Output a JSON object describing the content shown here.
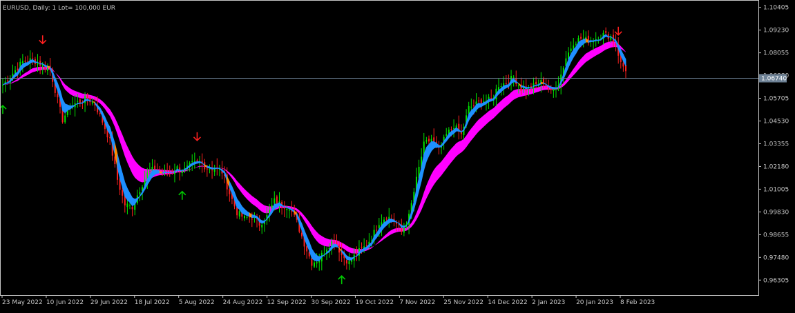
{
  "header": {
    "symbol_info": "EURUSD, Daily:  1 Lot= 100,000 EUR"
  },
  "chart_data": {
    "type": "candlestick",
    "symbol": "EURUSD",
    "timeframe": "Daily",
    "ylim": [
      0.9553,
      1.1075
    ],
    "y_ticks": [
      "1.10405",
      "1.09230",
      "1.08055",
      "1.06880",
      "1.05705",
      "1.04530",
      "1.03355",
      "1.02180",
      "1.01005",
      "0.99830",
      "0.98655",
      "0.97480",
      "0.96305"
    ],
    "x_ticks": [
      "23 May 2022",
      "10 Jun 2022",
      "29 Jun 2022",
      "18 Jul 2022",
      "5 Aug 2022",
      "24 Aug 2022",
      "12 Sep 2022",
      "30 Sep 2022",
      "19 Oct 2022",
      "7 Nov 2022",
      "25 Nov 2022",
      "14 Dec 2022",
      "2 Jan 2023",
      "20 Jan 2023",
      "8 Feb 2023"
    ],
    "current_price": "1.06740",
    "bar_count": 180,
    "close_path": [
      [
        0,
        1.064
      ],
      [
        4,
        1.07
      ],
      [
        8,
        1.076
      ],
      [
        12,
        1.077
      ],
      [
        16,
        1.074
      ],
      [
        19,
        1.072
      ],
      [
        22,
        1.056
      ],
      [
        24,
        1.046
      ],
      [
        27,
        1.053
      ],
      [
        30,
        1.055
      ],
      [
        34,
        1.057
      ],
      [
        37,
        1.054
      ],
      [
        40,
        1.045
      ],
      [
        43,
        1.035
      ],
      [
        46,
        1.015
      ],
      [
        49,
        1.002
      ],
      [
        52,
        1.001
      ],
      [
        55,
        1.01
      ],
      [
        58,
        1.018
      ],
      [
        61,
        1.021
      ],
      [
        64,
        1.018
      ],
      [
        67,
        1.019
      ],
      [
        70,
        1.021
      ],
      [
        73,
        1.02
      ],
      [
        76,
        1.023
      ],
      [
        79,
        1.024
      ],
      [
        82,
        1.021
      ],
      [
        85,
        1.021
      ],
      [
        88,
        1.019
      ],
      [
        91,
        1.008
      ],
      [
        94,
        0.998
      ],
      [
        97,
        0.995
      ],
      [
        100,
        0.996
      ],
      [
        103,
        0.992
      ],
      [
        106,
        0.996
      ],
      [
        109,
        1.004
      ],
      [
        112,
        1.002
      ],
      [
        115,
        1.001
      ],
      [
        118,
        0.993
      ],
      [
        121,
        0.982
      ],
      [
        124,
        0.972
      ],
      [
        127,
        0.974
      ],
      [
        130,
        0.98
      ],
      [
        133,
        0.984
      ],
      [
        136,
        0.976
      ],
      [
        139,
        0.972
      ],
      [
        142,
        0.977
      ],
      [
        145,
        0.98
      ],
      [
        148,
        0.985
      ],
      [
        151,
        0.993
      ],
      [
        154,
        0.996
      ],
      [
        157,
        0.994
      ],
      [
        160,
        0.988
      ],
      [
        163,
        0.996
      ],
      [
        166,
        1.015
      ],
      [
        169,
        1.033
      ],
      [
        172,
        1.036
      ],
      [
        175,
        1.03
      ],
      [
        178,
        1.038
      ],
      [
        181,
        1.043
      ],
      [
        184,
        1.038
      ],
      [
        187,
        1.052
      ],
      [
        190,
        1.054
      ],
      [
        193,
        1.056
      ],
      [
        196,
        1.056
      ],
      [
        199,
        1.064
      ],
      [
        202,
        1.065
      ],
      [
        205,
        1.068
      ],
      [
        208,
        1.062
      ],
      [
        211,
        1.062
      ],
      [
        214,
        1.064
      ],
      [
        217,
        1.066
      ],
      [
        220,
        1.06
      ],
      [
        223,
        1.065
      ],
      [
        226,
        1.078
      ],
      [
        229,
        1.086
      ],
      [
        232,
        1.088
      ],
      [
        235,
        1.087
      ],
      [
        238,
        1.088
      ],
      [
        241,
        1.09
      ],
      [
        244,
        1.089
      ],
      [
        246,
        1.085
      ],
      [
        248,
        1.075
      ],
      [
        250,
        1.072
      ]
    ],
    "signals": [
      {
        "type": "buy",
        "bar": 0
      },
      {
        "type": "sell",
        "bar": 16
      },
      {
        "type": "sell",
        "bar": 78
      },
      {
        "type": "buy",
        "bar": 72
      },
      {
        "type": "buy",
        "bar": 136
      },
      {
        "type": "sell",
        "bar": 247
      }
    ],
    "colors": {
      "background": "#000000",
      "frame": "#c8c8c8",
      "bull_candle": "#00e600",
      "bear_candle": "#ff2020",
      "fast_band": "#1e90ff",
      "fast_band_down": "#ff8c00",
      "slow_band": "#ff00ff",
      "price_line": "#6e8296",
      "price_label_bg": "#6e8296",
      "buy_arrow": "#00c800",
      "sell_arrow": "#ff2020"
    }
  }
}
